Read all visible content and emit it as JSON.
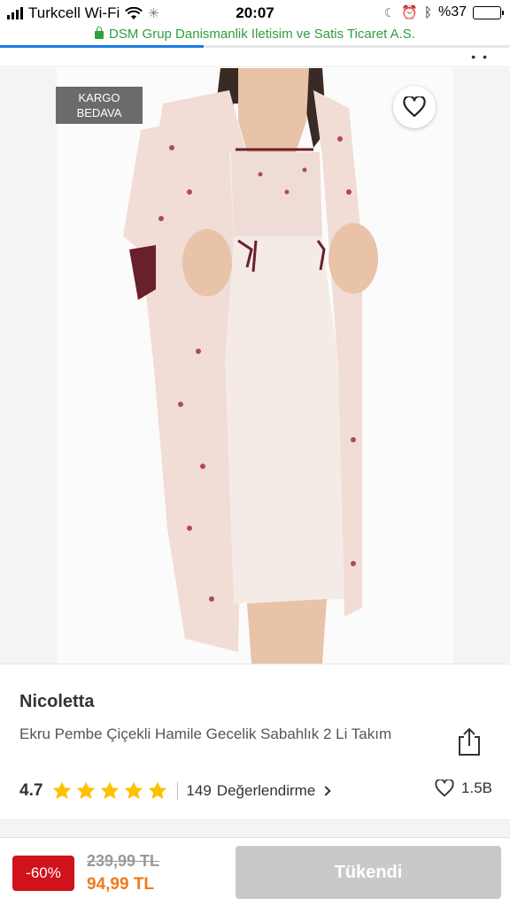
{
  "status_bar": {
    "carrier": "Turkcell Wi-Fi",
    "time": "20:07",
    "battery": "%37",
    "battery_level": 0.37
  },
  "url_bar": {
    "site_title": "DSM Grup Danismanlik Iletisim ve Satis Ticaret A.S.",
    "load_progress": 0.4
  },
  "product_image": {
    "badge_line1": "KARGO",
    "badge_line2": "BEDAVA"
  },
  "product": {
    "brand": "Nicoletta",
    "title": "Ekru Pembe Çiçekli Hamile Gecelik Sabahlık 2 Li Takım",
    "rating": "4.7",
    "stars_filled": 5,
    "review_count": "149",
    "review_label": "Değerlendirme",
    "favorites": "1.5B"
  },
  "purchase_bar": {
    "discount": "-60%",
    "old_price": "239,99 TL",
    "new_price": "94,99 TL",
    "button_label": "Tükendi"
  },
  "colors": {
    "accent_orange": "#f27a1a",
    "discount_red": "#d0121b",
    "star_yellow": "#ffc000",
    "secure_green": "#2e9e3e",
    "progress_blue": "#1a7de8"
  }
}
